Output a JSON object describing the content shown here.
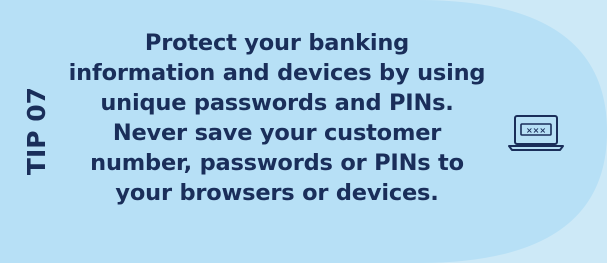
{
  "tip": {
    "label": "TIP 07",
    "text": "Protect your banking information and devices by using unique passwords and PINs. Never save your customer number, passwords or PINs to your browsers or devices."
  },
  "icons": {
    "illustration": "laptop-password-icon"
  },
  "colors": {
    "panel": "#b7e0f6",
    "text": "#1a2e5a"
  }
}
